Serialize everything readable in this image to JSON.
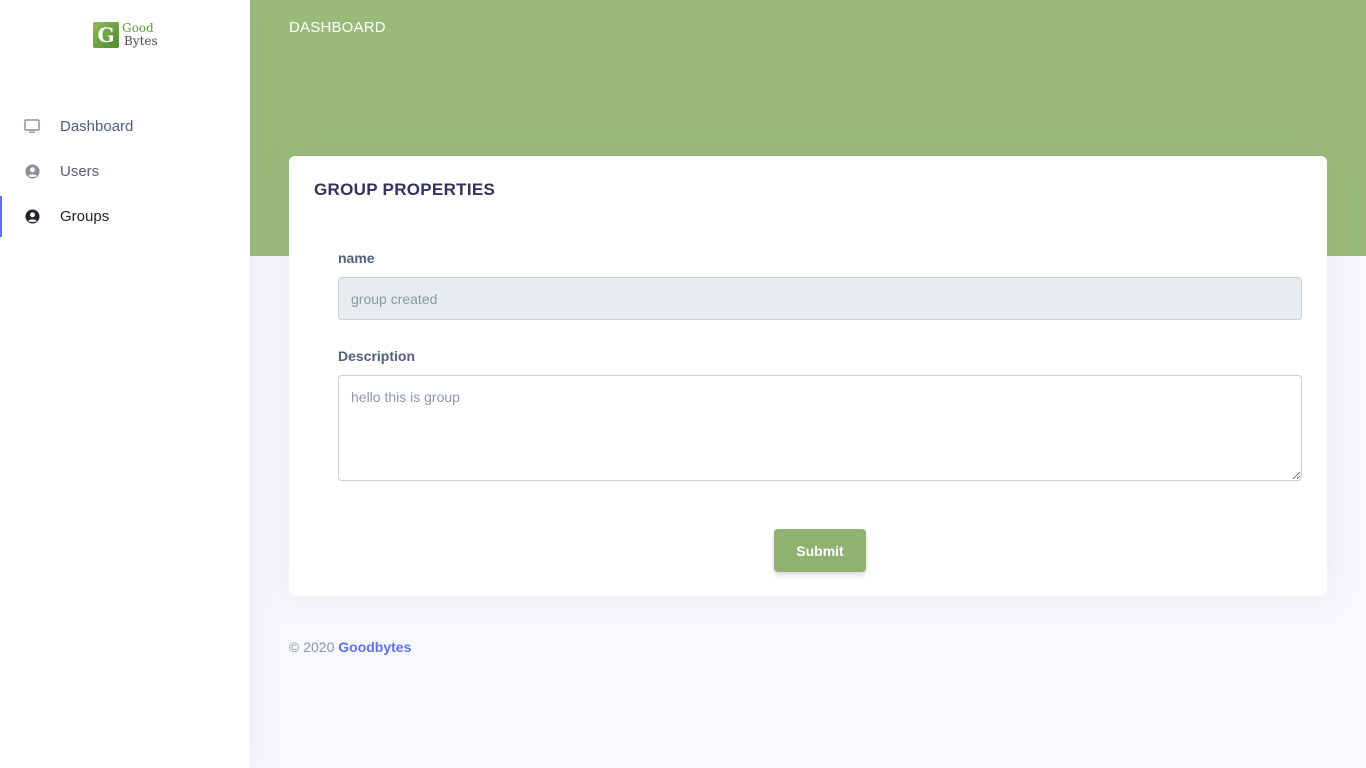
{
  "logo": {
    "mark": "G",
    "line1": "Good",
    "line2": "Bytes"
  },
  "sidebar": {
    "items": [
      {
        "label": "Dashboard",
        "icon": "monitor-icon",
        "active": false
      },
      {
        "label": "Users",
        "icon": "user-circle-icon",
        "active": false
      },
      {
        "label": "Groups",
        "icon": "user-circle-icon",
        "active": true
      }
    ]
  },
  "header": {
    "title": "DASHBOARD"
  },
  "card": {
    "title": "GROUP PROPERTIES",
    "name_label": "name",
    "name_placeholder": "group created",
    "description_label": "Description",
    "description_placeholder": "hello this is group",
    "submit_label": "Submit"
  },
  "footer": {
    "copyright": "© 2020",
    "link_text": "Goodbytes"
  },
  "colors": {
    "header_bg": "#99ba78",
    "submit_bg": "#8fb271",
    "accent": "#5e72e4"
  }
}
